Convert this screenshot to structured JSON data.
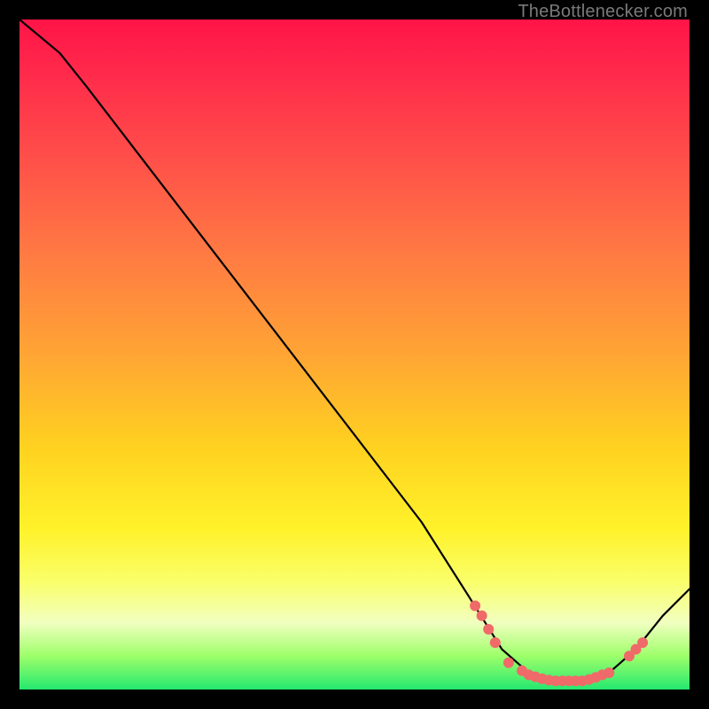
{
  "watermark": "TheBottlenecker.com",
  "chart_data": {
    "type": "line",
    "title": "",
    "xlabel": "",
    "ylabel": "",
    "xlim": [
      0,
      100
    ],
    "ylim": [
      0,
      100
    ],
    "curve": [
      {
        "x": 0,
        "y": 100
      },
      {
        "x": 6,
        "y": 95
      },
      {
        "x": 10,
        "y": 90
      },
      {
        "x": 20,
        "y": 77
      },
      {
        "x": 30,
        "y": 64
      },
      {
        "x": 40,
        "y": 51
      },
      {
        "x": 50,
        "y": 38
      },
      {
        "x": 60,
        "y": 25
      },
      {
        "x": 67,
        "y": 14
      },
      {
        "x": 72,
        "y": 6
      },
      {
        "x": 76,
        "y": 2.5
      },
      {
        "x": 80,
        "y": 1.3
      },
      {
        "x": 84,
        "y": 1.3
      },
      {
        "x": 88,
        "y": 2.5
      },
      {
        "x": 92,
        "y": 6
      },
      {
        "x": 96,
        "y": 11
      },
      {
        "x": 100,
        "y": 15
      }
    ],
    "markers": [
      {
        "x": 68,
        "y": 12.5
      },
      {
        "x": 69,
        "y": 11
      },
      {
        "x": 70,
        "y": 9
      },
      {
        "x": 71,
        "y": 7
      },
      {
        "x": 73,
        "y": 4
      },
      {
        "x": 75,
        "y": 2.8
      },
      {
        "x": 76,
        "y": 2.2
      },
      {
        "x": 77,
        "y": 1.9
      },
      {
        "x": 78,
        "y": 1.6
      },
      {
        "x": 79,
        "y": 1.4
      },
      {
        "x": 80,
        "y": 1.3
      },
      {
        "x": 81,
        "y": 1.3
      },
      {
        "x": 82,
        "y": 1.3
      },
      {
        "x": 83,
        "y": 1.3
      },
      {
        "x": 84,
        "y": 1.3
      },
      {
        "x": 85,
        "y": 1.5
      },
      {
        "x": 86,
        "y": 1.8
      },
      {
        "x": 87,
        "y": 2.2
      },
      {
        "x": 88,
        "y": 2.5
      },
      {
        "x": 91,
        "y": 5
      },
      {
        "x": 92,
        "y": 6
      },
      {
        "x": 93,
        "y": 7
      }
    ],
    "gradient_stops": [
      {
        "pos": 0,
        "color": "#ff1447"
      },
      {
        "pos": 50,
        "color": "#ffa534"
      },
      {
        "pos": 76,
        "color": "#fff22a"
      },
      {
        "pos": 100,
        "color": "#25e86f"
      }
    ]
  }
}
